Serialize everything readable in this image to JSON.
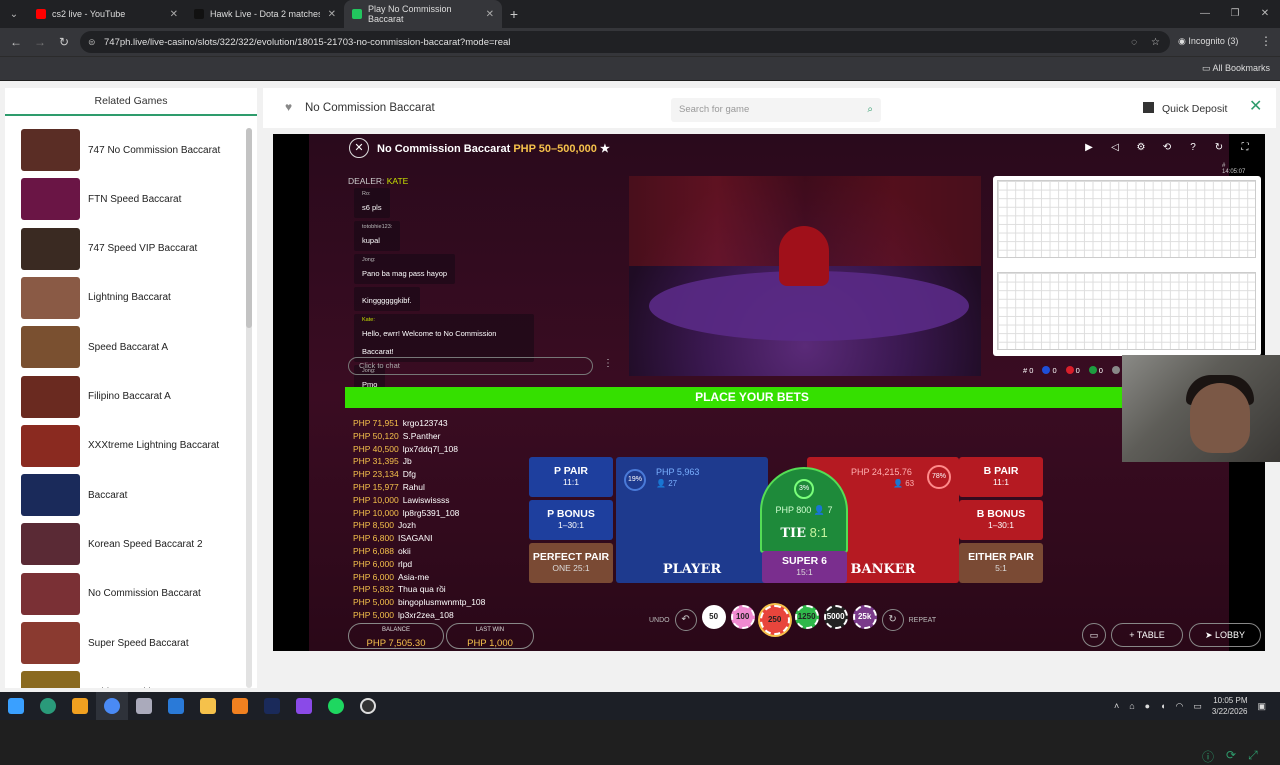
{
  "browser": {
    "tabs": [
      {
        "title": "cs2 live - YouTube",
        "favicon_color": "#ff0000"
      },
      {
        "title": "Hawk Live - Dota 2 matches live",
        "favicon_color": "#111111"
      },
      {
        "title": "Play No Commission Baccarat",
        "favicon_color": "#22c55e"
      }
    ],
    "url": "747ph.live/live-casino/slots/322/322/evolution/18015-21703-no-commission-baccarat?mode=real",
    "incognito_label": "Incognito (3)",
    "bookmarks_label": "All Bookmarks"
  },
  "sidebar": {
    "title": "Related Games",
    "games": [
      {
        "name": "747 No Commission Baccarat",
        "color": "#5a2d25"
      },
      {
        "name": "FTN Speed Baccarat",
        "color": "#6a1545"
      },
      {
        "name": "747 Speed VIP Baccarat",
        "color": "#3a2a22"
      },
      {
        "name": "Lightning Baccarat",
        "color": "#8a5a45"
      },
      {
        "name": "Speed Baccarat A",
        "color": "#7a5030"
      },
      {
        "name": "Filipino Baccarat A",
        "color": "#6a2a20"
      },
      {
        "name": "XXXtreme Lightning Baccarat",
        "color": "#8a2a20"
      },
      {
        "name": "Baccarat",
        "color": "#1a2a5a"
      },
      {
        "name": "Korean Speed Baccarat 2",
        "color": "#5a2a35"
      },
      {
        "name": "No Commission Baccarat",
        "color": "#7a3035"
      },
      {
        "name": "Super Speed Baccarat",
        "color": "#8a3a30"
      },
      {
        "name": "Golden Wealth Baccarat",
        "color": "#8a6a20"
      }
    ]
  },
  "header": {
    "title": "No Commission Baccarat",
    "search_placeholder": "Search for game",
    "quick_deposit": "Quick Deposit"
  },
  "game": {
    "name": "No Commission Baccarat",
    "limits": "PHP 50–500,000",
    "round_id": "# 14:05:07",
    "dealer_label": "DEALER:",
    "dealer_name": "KATE",
    "chat": [
      {
        "user": "Ro:",
        "text": "s6 pls"
      },
      {
        "user": "totobhie123:",
        "text": "kupal"
      },
      {
        "user": "Jong:",
        "text": "Pano ba mag pass hayop"
      },
      {
        "user": "",
        "text": "Kinggggggkibf."
      },
      {
        "user": "Kate:",
        "text": "Hello, ewrr! Welcome to No Commission Baccarat!"
      },
      {
        "user": "Jong:",
        "text": "Pmo"
      }
    ],
    "chat_placeholder": "Click to chat",
    "stats": [
      {
        "label": "# 0",
        "color": "#ffffff"
      },
      {
        "label": "0",
        "color": "#1e4fd8"
      },
      {
        "label": "0",
        "color": "#d81e2a"
      },
      {
        "label": "0",
        "color": "#1e9c40"
      },
      {
        "label": "0",
        "color": "#888888"
      }
    ],
    "bet_banner": "PLACE YOUR BETS",
    "winners": [
      {
        "amount": "PHP 71,951",
        "name": "krgo123743"
      },
      {
        "amount": "PHP 50,120",
        "name": "S.Panther"
      },
      {
        "amount": "PHP 40,500",
        "name": "lpx7ddq7l_108"
      },
      {
        "amount": "PHP 31,395",
        "name": "Jb"
      },
      {
        "amount": "PHP 23,134",
        "name": "Dfg"
      },
      {
        "amount": "PHP 15,977",
        "name": "Rahul"
      },
      {
        "amount": "PHP 10,000",
        "name": "Lawiswissss"
      },
      {
        "amount": "PHP 10,000",
        "name": "lp8rg5391_108"
      },
      {
        "amount": "PHP 8,500",
        "name": "Jozh"
      },
      {
        "amount": "PHP 6,800",
        "name": "ISAGANI"
      },
      {
        "amount": "PHP 6,088",
        "name": "okii"
      },
      {
        "amount": "PHP 6,000",
        "name": "rlpd"
      },
      {
        "amount": "PHP 6,000",
        "name": "Asia-me"
      },
      {
        "amount": "PHP 5,832",
        "name": "Thua qua rồi"
      },
      {
        "amount": "PHP 5,000",
        "name": "bingoplusmwnmtp_108"
      },
      {
        "amount": "PHP 5,000",
        "name": "lp3xr2zea_108"
      }
    ],
    "balance_label": "BALANCE",
    "balance_value": "PHP 7,505.30",
    "lastwin_label": "LAST WIN",
    "lastwin_value": "PHP 1,000",
    "bets": {
      "p_pair": {
        "label": "P PAIR",
        "odds": "11:1"
      },
      "p_bonus": {
        "label": "P BONUS",
        "odds": "1–30:1"
      },
      "perfect_pair": {
        "label": "PERFECT PAIR",
        "odds": "ONE 25:1"
      },
      "player": {
        "label": "PLAYER",
        "total": "PHP 5,963",
        "players": "27",
        "pct": "19%"
      },
      "tie": {
        "label": "TIE",
        "odds": "8:1",
        "total": "PHP 800",
        "players": "7",
        "pct": "3%"
      },
      "super6": {
        "label": "SUPER 6",
        "odds": "15:1"
      },
      "banker": {
        "label": "BANKER",
        "total": "PHP 24,215.76",
        "players": "63",
        "pct": "78%"
      },
      "b_pair": {
        "label": "B PAIR",
        "odds": "11:1"
      },
      "b_bonus": {
        "label": "B BONUS",
        "odds": "1–30:1"
      },
      "either_pair": {
        "label": "EITHER PAIR",
        "odds": "5:1"
      }
    },
    "undo_label": "UNDO",
    "repeat_label": "REPEAT",
    "chips": [
      {
        "value": "50",
        "color": "#ffffff"
      },
      {
        "value": "100",
        "color": "#f08ad0"
      },
      {
        "value": "250",
        "color": "#e8453c"
      },
      {
        "value": "1250",
        "color": "#2fb84a"
      },
      {
        "value": "5000",
        "color": "#222222"
      },
      {
        "value": "25k",
        "color": "#7a3a8a"
      }
    ],
    "table_label": "TABLE",
    "lobby_label": "LOBBY"
  },
  "taskbar": {
    "time": "10:05 PM",
    "date": "3/22/2026"
  }
}
